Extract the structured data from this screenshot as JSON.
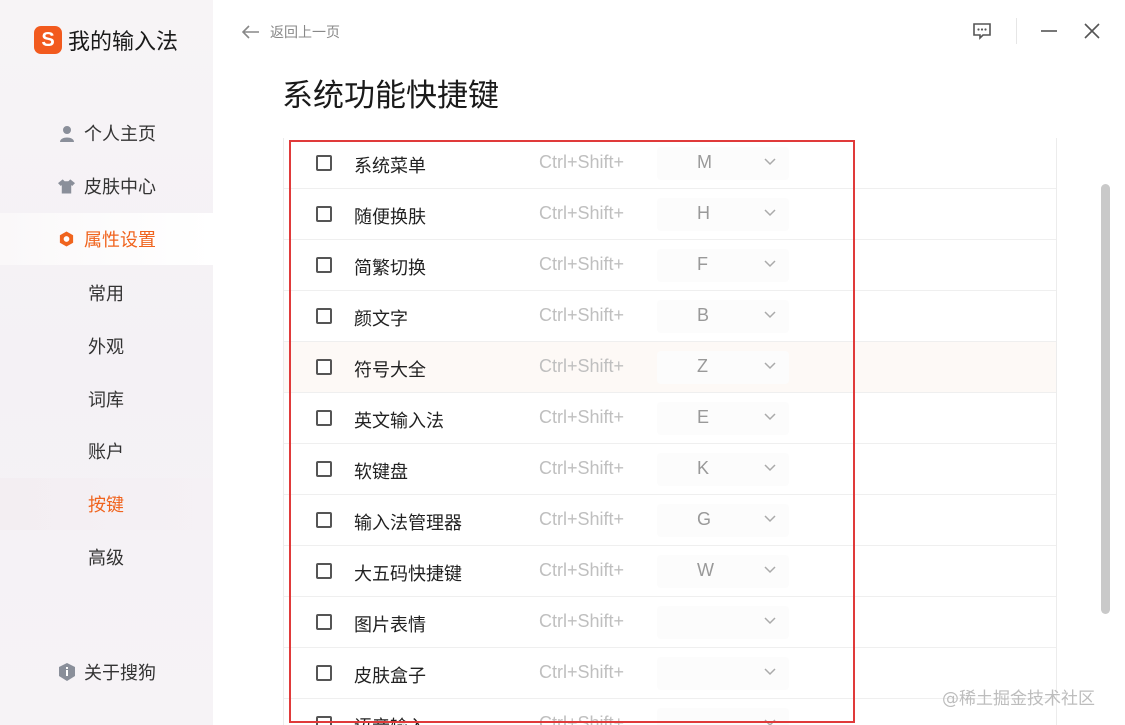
{
  "app": {
    "logo_letter": "S",
    "title": "我的输入法",
    "accent_color": "#f0641e"
  },
  "sidebar": {
    "nav": [
      {
        "label": "个人主页",
        "icon": "person-icon"
      },
      {
        "label": "皮肤中心",
        "icon": "shirt-icon"
      },
      {
        "label": "属性设置",
        "icon": "hexagon-gear-icon",
        "active": true
      }
    ],
    "sub": [
      {
        "label": "常用"
      },
      {
        "label": "外观"
      },
      {
        "label": "词库"
      },
      {
        "label": "账户"
      },
      {
        "label": "按键",
        "active": true
      },
      {
        "label": "高级"
      }
    ],
    "about": {
      "label": "关于搜狗",
      "icon": "info-shield-icon"
    }
  },
  "header": {
    "back_label": "返回上一页",
    "page_title": "系统功能快捷键"
  },
  "shortcuts": [
    {
      "label": "系统菜单",
      "modifier": "Ctrl+Shift+",
      "key": "M",
      "checked": false
    },
    {
      "label": "随便换肤",
      "modifier": "Ctrl+Shift+",
      "key": "H",
      "checked": false
    },
    {
      "label": "简繁切换",
      "modifier": "Ctrl+Shift+",
      "key": "F",
      "checked": false
    },
    {
      "label": "颜文字",
      "modifier": "Ctrl+Shift+",
      "key": "B",
      "checked": false
    },
    {
      "label": "符号大全",
      "modifier": "Ctrl+Shift+",
      "key": "Z",
      "checked": false
    },
    {
      "label": "英文输入法",
      "modifier": "Ctrl+Shift+",
      "key": "E",
      "checked": false
    },
    {
      "label": "软键盘",
      "modifier": "Ctrl+Shift+",
      "key": "K",
      "checked": false
    },
    {
      "label": "输入法管理器",
      "modifier": "Ctrl+Shift+",
      "key": "G",
      "checked": false
    },
    {
      "label": "大五码快捷键",
      "modifier": "Ctrl+Shift+",
      "key": "W",
      "checked": false
    },
    {
      "label": "图片表情",
      "modifier": "Ctrl+Shift+",
      "key": "",
      "checked": false
    },
    {
      "label": "皮肤盒子",
      "modifier": "Ctrl+Shift+",
      "key": "",
      "checked": false
    },
    {
      "label": "语音输入",
      "modifier": "Ctrl+Shift+",
      "key": "",
      "checked": false
    }
  ],
  "highlighted_row": 4,
  "watermark": "@稀土掘金技术社区"
}
